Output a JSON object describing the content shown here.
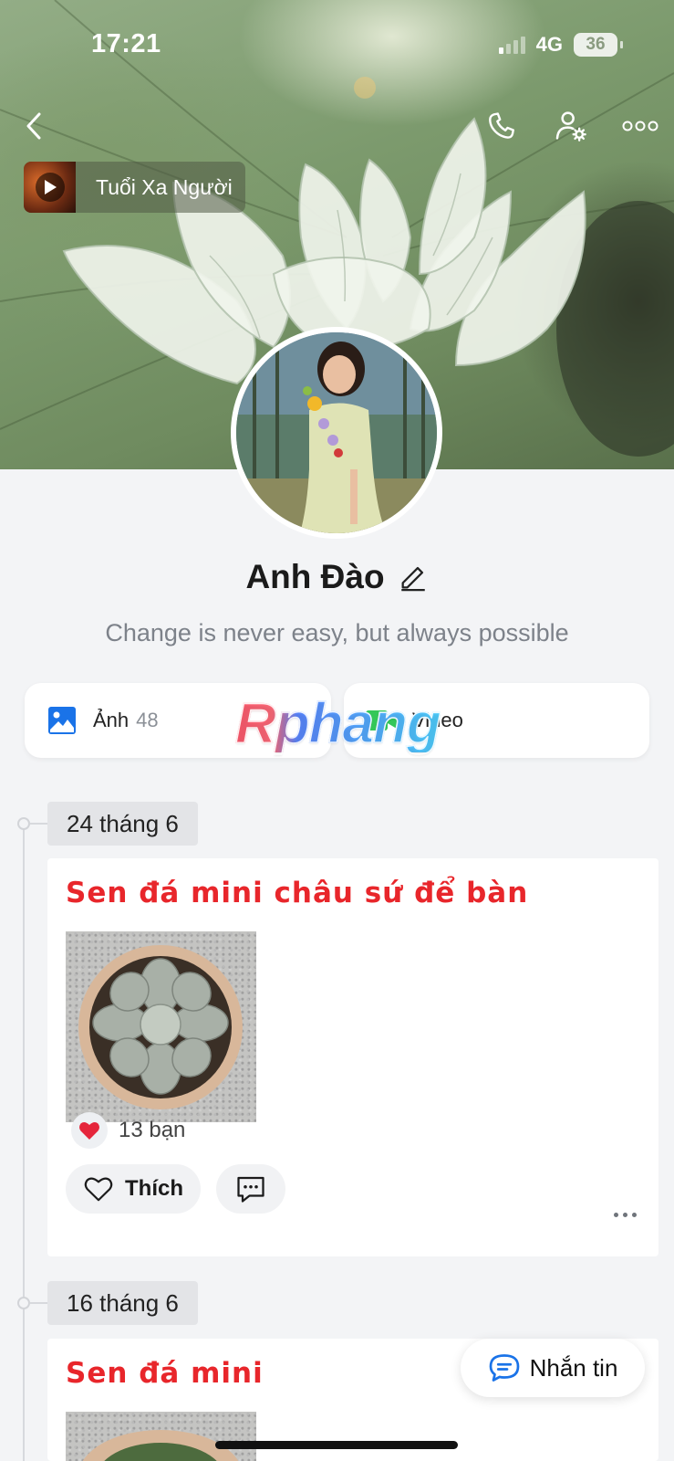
{
  "status_bar": {
    "time": "17:21",
    "network": "4G",
    "battery": "36"
  },
  "music": {
    "title": "Tuổi Xa Người"
  },
  "profile": {
    "name": "Anh Đào",
    "bio": "Change is never easy, but always possible"
  },
  "media": {
    "photos_label": "Ảnh",
    "photos_count": "48",
    "video_label": "Video"
  },
  "watermark": "Rphang",
  "posts": [
    {
      "date": "24 tháng 6",
      "title": "Sen đá mini châu sứ để bàn",
      "reactions": "13 bạn",
      "like_label": "Thích"
    },
    {
      "date": "16 tháng 6",
      "title": "Sen đá mini"
    }
  ],
  "message_button": {
    "label": "Nhắn tin"
  },
  "colors": {
    "accent_blue": "#1a73e8",
    "post_title_red": "#e8262b",
    "video_green": "#34c759",
    "heart_red": "#e5253b"
  },
  "icons": [
    "back-icon",
    "phone-icon",
    "user-settings-icon",
    "more-icon",
    "play-icon",
    "edit-pencil-icon",
    "photo-icon",
    "video-camera-icon",
    "heart-icon",
    "comment-icon",
    "message-icon"
  ]
}
